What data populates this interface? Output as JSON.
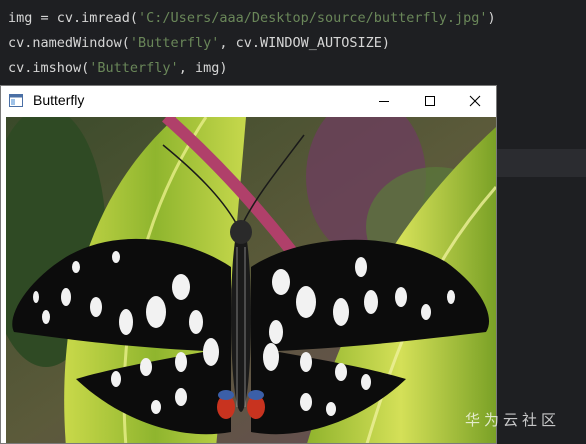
{
  "code": {
    "lines": [
      {
        "prefix": "img = cv.imread(",
        "string": "'C:/Users/aaa/Desktop/source/butterfly.jpg'",
        "suffix": ")"
      },
      {
        "prefix": "cv.namedWindow(",
        "string": "'Butterfly'",
        "suffix": ", cv.WINDOW_AUTOSIZE)"
      },
      {
        "prefix": "cv.imshow(",
        "string": "'Butterfly'",
        "suffix": ", img)"
      }
    ]
  },
  "window": {
    "title": "Butterfly",
    "icon": "app-window-icon",
    "controls": [
      "minimize-icon",
      "maximize-icon",
      "close-icon"
    ]
  },
  "image": {
    "subject": "butterfly-photo"
  },
  "watermark": "华为云社区",
  "colors": {
    "editor_bg": "#1e1f22",
    "code_text": "#d6d6d6",
    "string_literal": "#6a8759",
    "titlebar_bg": "#ffffff"
  }
}
